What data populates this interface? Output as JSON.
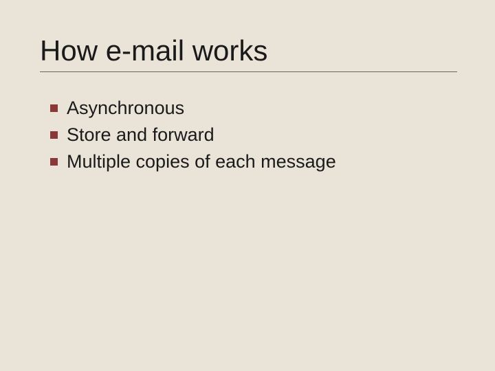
{
  "slide": {
    "title": "How e-mail works",
    "bullets": [
      {
        "text": "Asynchronous"
      },
      {
        "text": "Store and forward"
      },
      {
        "text": "Multiple copies of each message"
      }
    ]
  }
}
